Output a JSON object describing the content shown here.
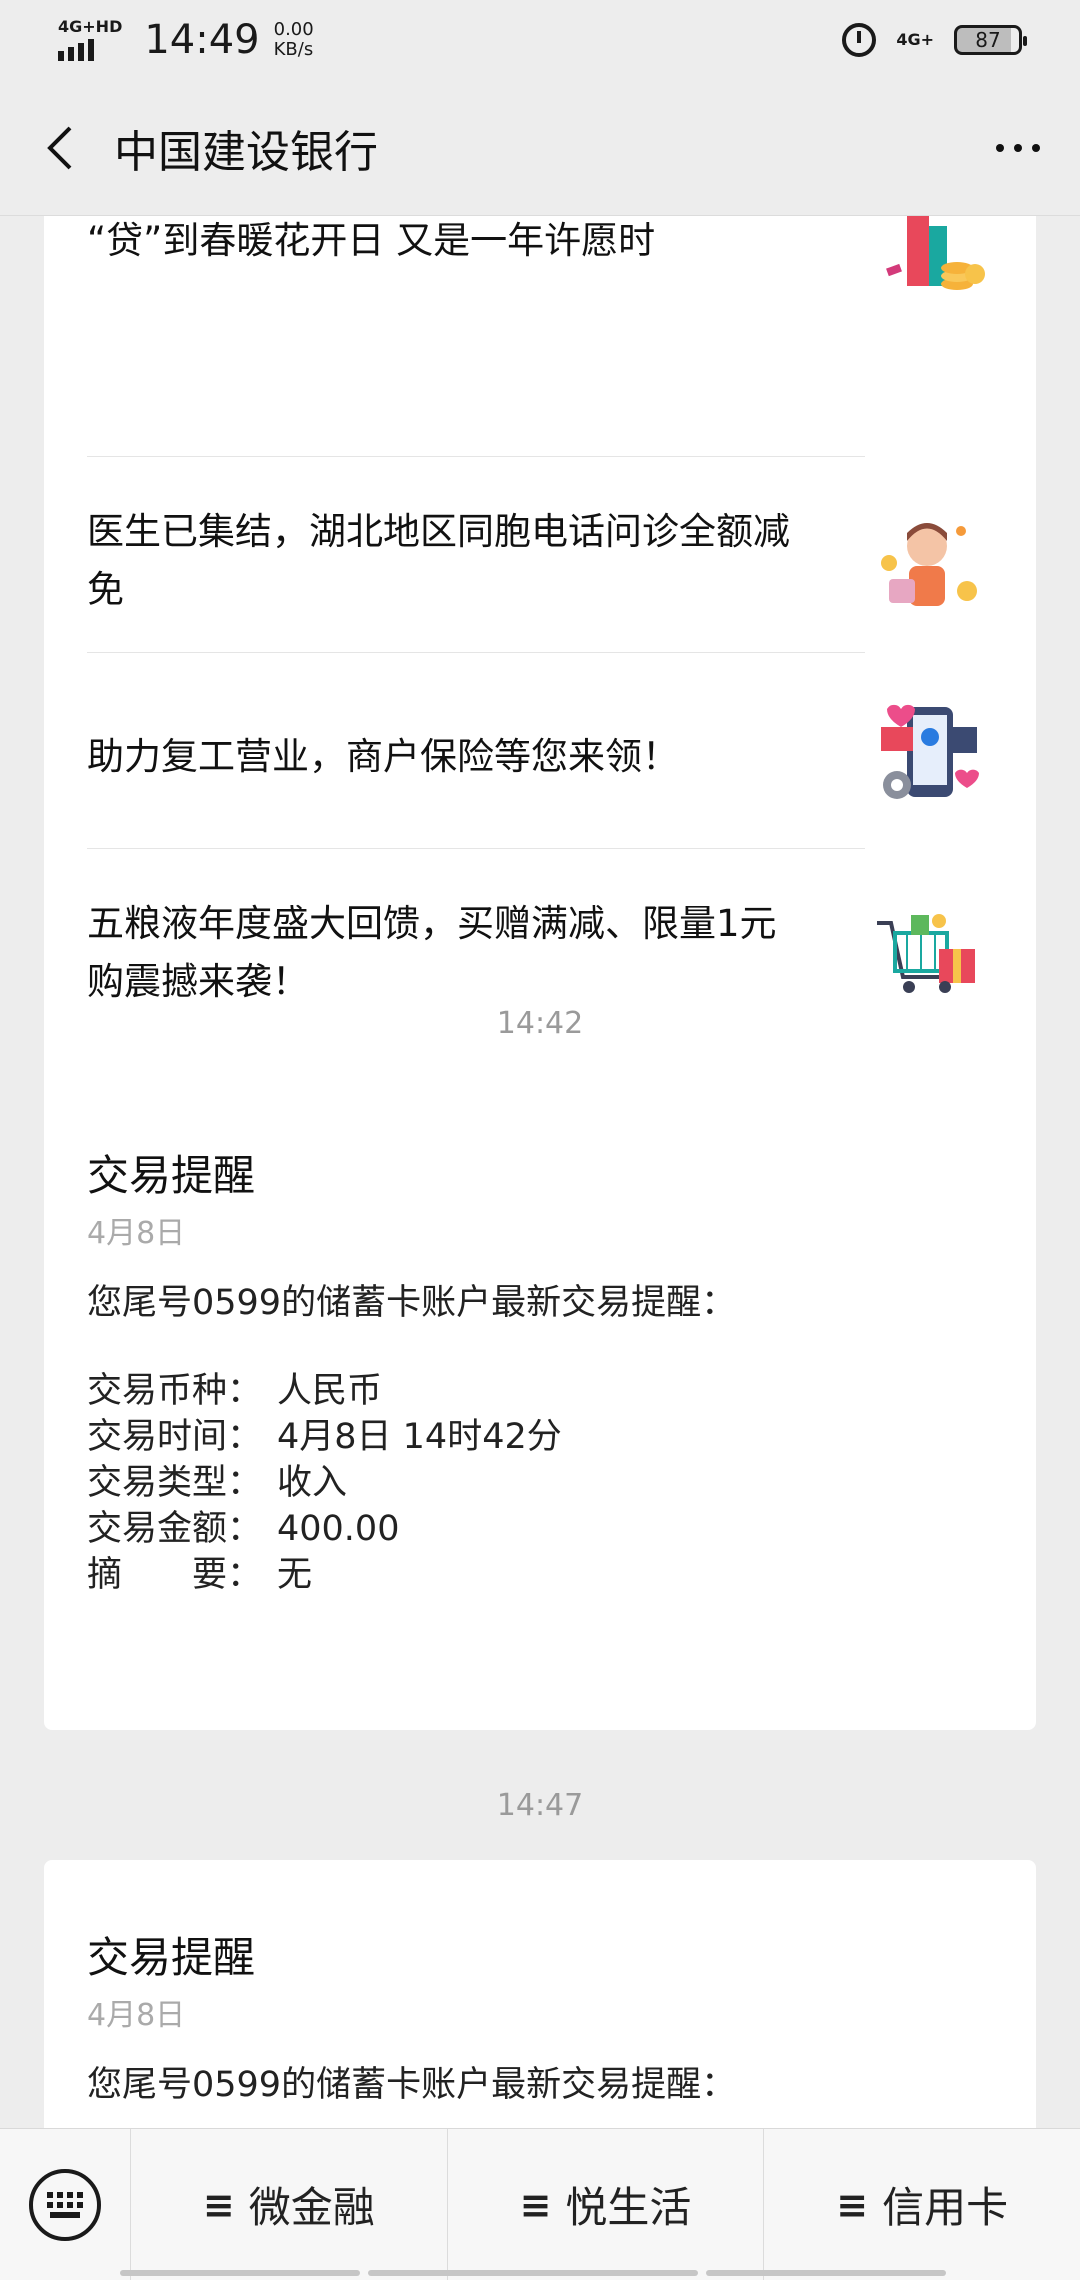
{
  "status_bar": {
    "network_label": "4G+HD",
    "time": "14:49",
    "speed_value": "0.00",
    "speed_unit": "KB/s",
    "net_right": "4G+",
    "battery": "87"
  },
  "header": {
    "title": "中国建设银行",
    "back_icon": "chevron-left-icon",
    "more_icon": "more-dots-icon"
  },
  "news": [
    {
      "text": "“贷”到春暖花开日 又是一年许愿时",
      "icon": "coins-illustration"
    },
    {
      "text": "医生已集结，湖北地区同胞电话问诊全额减免",
      "icon": "doctor-illustration"
    },
    {
      "text": "助力复工营业，商户保险等您来领！",
      "icon": "phone-pay-illustration"
    },
    {
      "text": "五粮液年度盛大回馈，买赠满减、限量1元购震撼来袭！",
      "icon": "shopping-cart-illustration"
    }
  ],
  "messages": [
    {
      "timestamp": "14:42",
      "title": "交易提醒",
      "date": "4月8日",
      "intro": "您尾号0599的储蓄卡账户最新交易提醒：",
      "rows": [
        {
          "key": "交易币种：",
          "value": "人民币"
        },
        {
          "key": "交易时间：",
          "value": "4月8日 14时42分"
        },
        {
          "key": "交易类型：",
          "value": "收入"
        },
        {
          "key": "交易金额：",
          "value": "400.00"
        },
        {
          "key": "摘　　要：",
          "value": "无"
        }
      ]
    },
    {
      "timestamp": "14:47",
      "title": "交易提醒",
      "date": "4月8日",
      "intro": "您尾号0599的储蓄卡账户最新交易提醒："
    }
  ],
  "bottom_menu": {
    "keyboard_icon": "keyboard-icon",
    "items": [
      {
        "label": "微金融"
      },
      {
        "label": "悦生活"
      },
      {
        "label": "信用卡"
      }
    ]
  }
}
